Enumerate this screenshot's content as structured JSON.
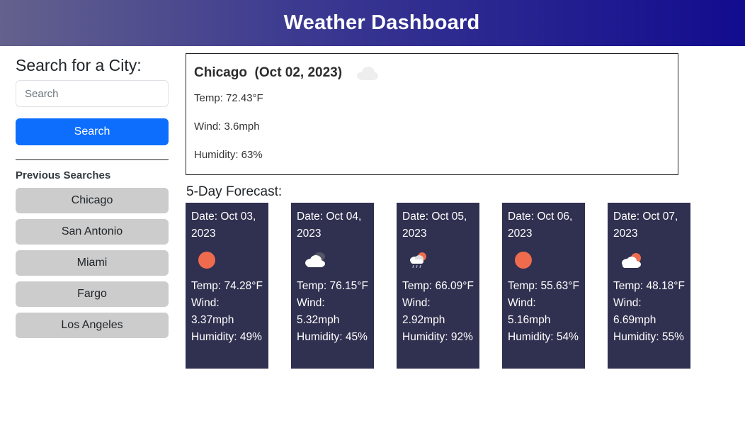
{
  "header": {
    "title": "Weather Dashboard"
  },
  "sidebar": {
    "heading": "Search for a City:",
    "search_placeholder": "Search",
    "search_button": "Search",
    "previous_heading": "Previous Searches",
    "history": [
      "Chicago",
      "San Antonio",
      "Miami",
      "Fargo",
      "Los Angeles"
    ]
  },
  "current": {
    "city": "Chicago",
    "date": "(Oct 02, 2023)",
    "icon": "cloud-icon",
    "temp": "Temp: 72.43°F",
    "wind": "Wind: 3.6mph",
    "humidity": "Humidity: 63%"
  },
  "forecast": {
    "heading": "5-Day Forecast:",
    "days": [
      {
        "date": "Date: Oct 03, 2023",
        "icon": "sun-icon",
        "temp": "Temp: 74.28°F",
        "wind": "Wind: 3.37mph",
        "humidity": "Humidity: 49%"
      },
      {
        "date": "Date: Oct 04, 2023",
        "icon": "broken-clouds-icon",
        "temp": "Temp: 76.15°F",
        "wind": "Wind: 5.32mph",
        "humidity": "Humidity: 45%"
      },
      {
        "date": "Date: Oct 05, 2023",
        "icon": "rain-icon",
        "temp": "Temp: 66.09°F",
        "wind": "Wind: 2.92mph",
        "humidity": "Humidity: 92%"
      },
      {
        "date": "Date: Oct 06, 2023",
        "icon": "sun-icon",
        "temp": "Temp: 55.63°F",
        "wind": "Wind: 5.16mph",
        "humidity": "Humidity: 54%"
      },
      {
        "date": "Date: Oct 07, 2023",
        "icon": "partly-cloudy-icon",
        "temp": "Temp: 48.18°F",
        "wind": "Wind: 6.69mph",
        "humidity": "Humidity: 55%"
      }
    ]
  },
  "colors": {
    "header_gradient_start": "#64618d",
    "header_gradient_end": "#120c8f",
    "search_button": "#0d6efd",
    "history_button": "#cccccc",
    "forecast_card": "#303050",
    "sun": "#ee6c4d"
  }
}
